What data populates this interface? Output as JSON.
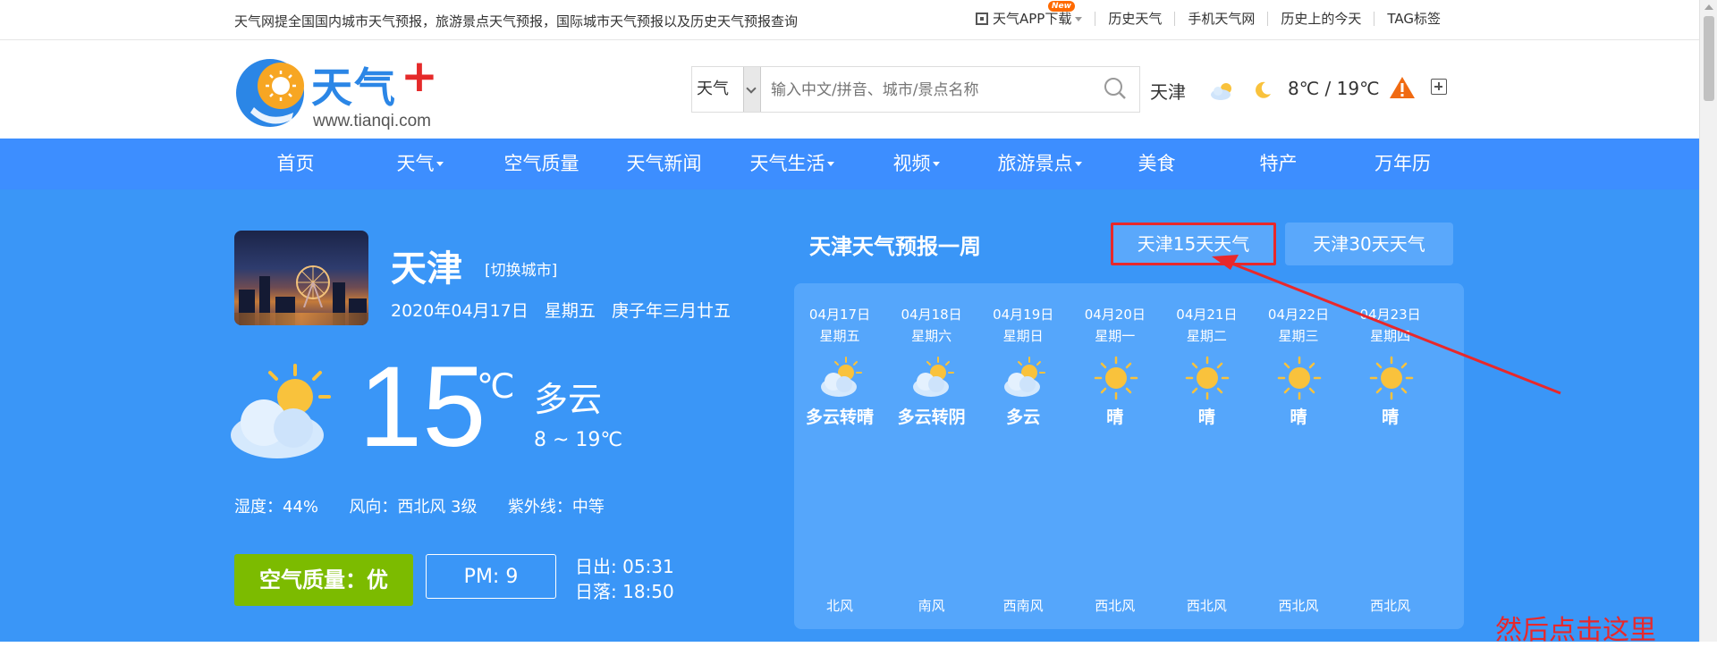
{
  "topbar": {
    "tagline": "天气网提全国国内城市天气预报，旅游景点天气预报，国际城市天气预报以及历史天气预报查询",
    "links": [
      {
        "label": "天气APP下载",
        "badge": "New"
      },
      {
        "label": "历史天气"
      },
      {
        "label": "手机天气网"
      },
      {
        "label": "历史上的今天"
      },
      {
        "label": "TAG标签"
      }
    ]
  },
  "header": {
    "logo_title": "天气",
    "logo_plus": "+",
    "logo_url": "www.tianqi.com",
    "search": {
      "select_value": "天气",
      "placeholder": "输入中文/拼音、城市/景点名称"
    },
    "city": "天津",
    "temp": "8℃ / 19℃"
  },
  "nav": [
    "首页",
    "天气",
    "空气质量",
    "天气新闻",
    "天气生活",
    "视频",
    "旅游景点",
    "美食",
    "特产",
    "万年历"
  ],
  "current": {
    "city": "天津",
    "switch": "[切换城市]",
    "date": "2020年04月17日   星期五   庚子年三月廿五",
    "temp": "15",
    "unit": "℃",
    "condition": "多云",
    "range": "8 ~ 19℃",
    "stats": "湿度：44%      风向：西北风 3级      紫外线：中等",
    "aqi": "空气质量：优",
    "pm": "PM: 9",
    "sunrise": "日出: 05:31",
    "sunset": "日落: 18:50"
  },
  "week": {
    "title": "天津天气预报一周",
    "btn15": "天津15天天气",
    "btn30": "天津30天天气",
    "days": [
      {
        "date": "04月17日",
        "weekday": "星期五",
        "icon": "partly-cloudy-icon",
        "condition": "多云转晴",
        "wind": "北风"
      },
      {
        "date": "04月18日",
        "weekday": "星期六",
        "icon": "partly-cloudy-icon",
        "condition": "多云转阴",
        "wind": "南风"
      },
      {
        "date": "04月19日",
        "weekday": "星期日",
        "icon": "partly-cloudy-icon",
        "condition": "多云",
        "wind": "西南风"
      },
      {
        "date": "04月20日",
        "weekday": "星期一",
        "icon": "sun-icon",
        "condition": "晴",
        "wind": "西北风"
      },
      {
        "date": "04月21日",
        "weekday": "星期二",
        "icon": "sun-icon",
        "condition": "晴",
        "wind": "西北风"
      },
      {
        "date": "04月22日",
        "weekday": "星期三",
        "icon": "sun-icon",
        "condition": "晴",
        "wind": "西北风"
      },
      {
        "date": "04月23日",
        "weekday": "星期四",
        "icon": "sun-icon",
        "condition": "晴",
        "wind": "西北风"
      }
    ]
  },
  "annotation": "然后点击这里",
  "colors": {
    "nav": "#3d8eff",
    "main": "#3a96f7",
    "aqi_good": "#7cbb00",
    "highlight": "#e8282b"
  }
}
